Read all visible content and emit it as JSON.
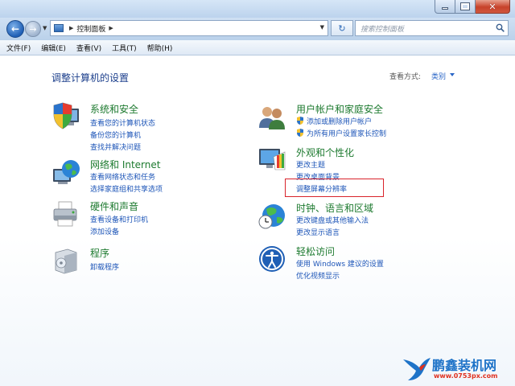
{
  "window": {
    "controls": {
      "min": "minimize",
      "max": "maximize",
      "close": "close"
    }
  },
  "nav": {
    "address_text": "控制面板",
    "search_placeholder": "搜索控制面板"
  },
  "menu": [
    "文件(F)",
    "编辑(E)",
    "查看(V)",
    "工具(T)",
    "帮助(H)"
  ],
  "page": {
    "title": "调整计算机的设置",
    "view_by_label": "查看方式:",
    "view_by_value": "类别"
  },
  "categories": {
    "security": {
      "title": "系统和安全",
      "links": [
        "查看您的计算机状态",
        "备份您的计算机",
        "查找并解决问题"
      ]
    },
    "network": {
      "title": "网络和 Internet",
      "links": [
        "查看网络状态和任务",
        "选择家庭组和共享选项"
      ]
    },
    "hardware": {
      "title": "硬件和声音",
      "links": [
        "查看设备和打印机",
        "添加设备"
      ]
    },
    "programs": {
      "title": "程序",
      "links": [
        "卸载程序"
      ]
    },
    "users": {
      "title": "用户帐户和家庭安全",
      "links": [
        "添加或删除用户帐户",
        "为所有用户设置家长控制"
      ]
    },
    "appearance": {
      "title": "外观和个性化",
      "links": [
        "更改主题",
        "更改桌面背景",
        "调整屏幕分辨率"
      ]
    },
    "clock": {
      "title": "时钟、语言和区域",
      "links": [
        "更改键盘或其他输入法",
        "更改显示语言"
      ]
    },
    "ease": {
      "title": "轻松访问",
      "links": [
        "使用 Windows 建议的设置",
        "优化视频显示"
      ]
    }
  },
  "watermark": {
    "brand": "鹏鑫装机网",
    "url": "www.0753px.com"
  },
  "colors": {
    "category_title": "#1d7a2f",
    "link": "#1e56b8",
    "highlight_box": "#d9232b",
    "page_title": "#1c3f8c"
  },
  "icons": {
    "security": "shield-computer-icon",
    "network": "globe-network-icon",
    "hardware": "printer-icon",
    "programs": "programs-box-icon",
    "users": "users-icon",
    "appearance": "monitor-palette-icon",
    "clock": "clock-globe-icon",
    "ease": "ease-of-access-icon"
  }
}
